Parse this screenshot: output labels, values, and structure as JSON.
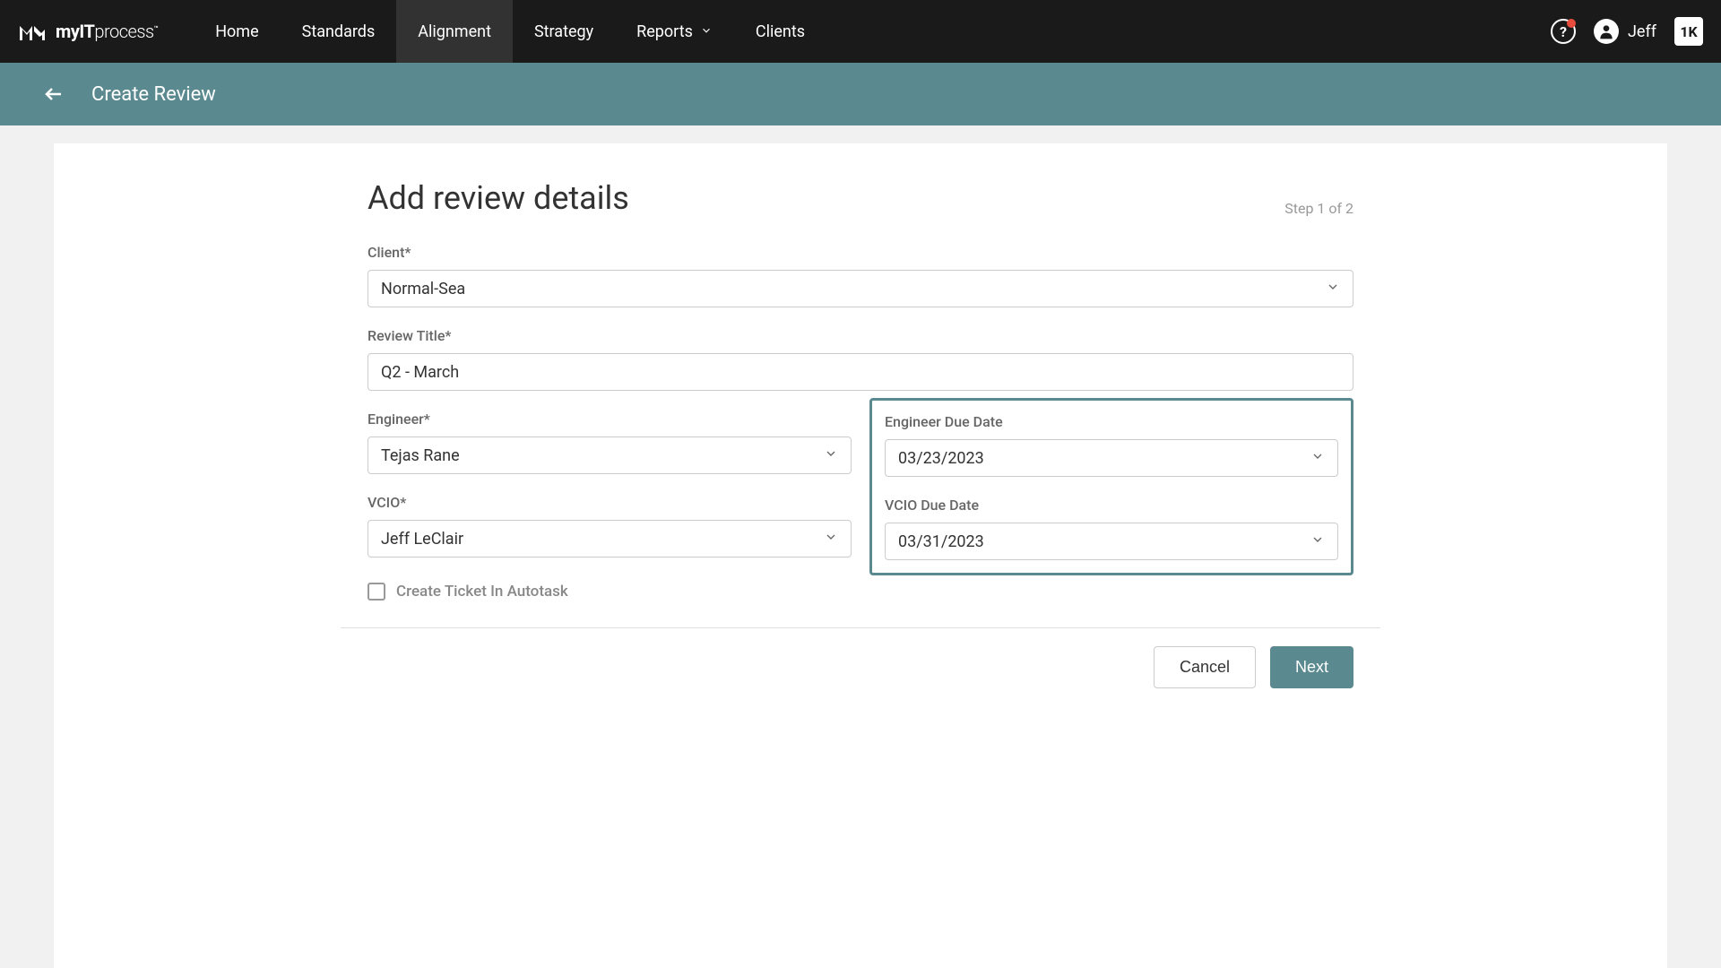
{
  "nav": {
    "logo_text": "myITprocess",
    "links": [
      {
        "label": "Home",
        "active": false
      },
      {
        "label": "Standards",
        "active": false
      },
      {
        "label": "Alignment",
        "active": true
      },
      {
        "label": "Strategy",
        "active": false
      },
      {
        "label": "Reports",
        "active": false,
        "dropdown": true
      },
      {
        "label": "Clients",
        "active": false
      }
    ],
    "user_name": "Jeff",
    "app_badge": "1K"
  },
  "sub_header": {
    "title": "Create Review"
  },
  "form": {
    "title": "Add review details",
    "step": "Step 1 of 2",
    "fields": {
      "client": {
        "label": "Client*",
        "value": "Normal-Sea"
      },
      "review_title": {
        "label": "Review Title*",
        "value": "Q2 - March"
      },
      "engineer": {
        "label": "Engineer*",
        "value": "Tejas Rane"
      },
      "engineer_due_date": {
        "label": "Engineer Due Date",
        "value": "03/23/2023"
      },
      "vcio": {
        "label": "VCIO*",
        "value": "Jeff LeClair"
      },
      "vcio_due_date": {
        "label": "VCIO Due Date",
        "value": "03/31/2023"
      },
      "create_ticket": {
        "label": "Create Ticket In Autotask"
      }
    },
    "buttons": {
      "cancel": "Cancel",
      "next": "Next"
    }
  }
}
